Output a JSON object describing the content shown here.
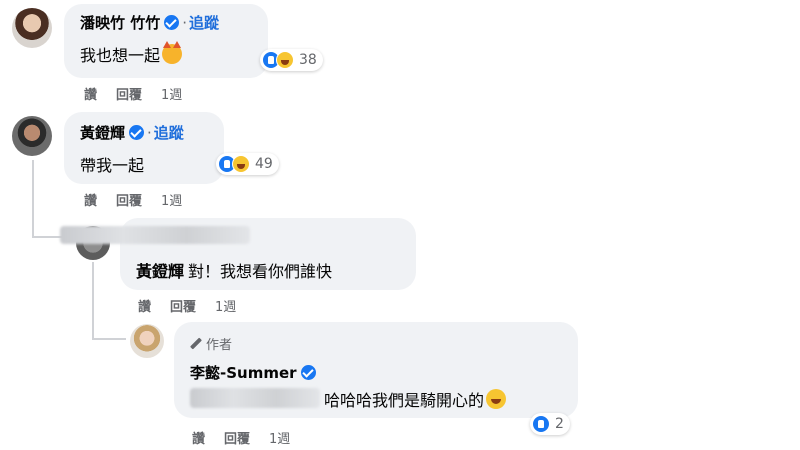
{
  "comments": [
    {
      "name": "潘映竹 竹竹",
      "follow": "追蹤",
      "text": "我也想一起",
      "emoji": "smiling-devil-emoji",
      "reaction_count": "38",
      "actions": {
        "like": "讚",
        "reply": "回覆",
        "time": "1週"
      }
    },
    {
      "name": "黃鐙輝",
      "follow": "追蹤",
      "text": "帶我一起",
      "reaction_count": "49",
      "actions": {
        "like": "讚",
        "reply": "回覆",
        "time": "1週"
      }
    },
    {
      "mention": "黃鐙輝",
      "text": "對！我想看你們誰快",
      "actions": {
        "like": "讚",
        "reply": "回覆",
        "time": "1週"
      }
    },
    {
      "author_tag": "作者",
      "name": "李懿-Summer",
      "text": "哈哈哈我們是騎開心的",
      "emoji": "laughing-emoji",
      "reaction_count": "2",
      "actions": {
        "like": "讚",
        "reply": "回覆",
        "time": "1週"
      }
    }
  ],
  "separator": "·",
  "colors": {
    "bubble": "#f0f2f5",
    "link": "#216fdb",
    "verified": "#1877f2",
    "muted": "#65676b"
  }
}
